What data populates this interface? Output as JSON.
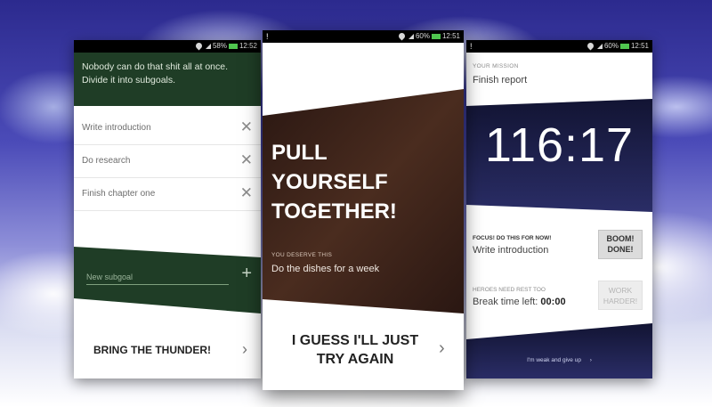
{
  "colors": {
    "forest_green": "#1f3d26",
    "brown_dark": "#3a2218",
    "navy": "#1c1e4a",
    "battery_green": "#4fc64f"
  },
  "phone1": {
    "status": {
      "battery": "58%",
      "time": "12:52"
    },
    "intro": "Nobody can do that shit all at once. Divide it into subgoals.",
    "subgoals": [
      {
        "label": "Write introduction"
      },
      {
        "label": "Do research"
      },
      {
        "label": "Finish chapter one"
      }
    ],
    "remove_glyph": "✕",
    "new_subgoal_placeholder": "New subgoal",
    "add_glyph": "+",
    "cta_label": "BRING THE THUNDER!",
    "cta_chevron": "›"
  },
  "phone2": {
    "status": {
      "alert": "!",
      "battery": "60%",
      "time": "12:51"
    },
    "headline_lines": [
      "PULL",
      "YOURSELF",
      "TOGETHER!"
    ],
    "reward_label": "YOU DESERVE THIS",
    "reward_text": "Do the dishes for a week",
    "cta_lines": [
      "I GUESS I'LL JUST",
      "TRY AGAIN"
    ],
    "cta_chevron": "›"
  },
  "phone3": {
    "status": {
      "alert": "!",
      "battery": "60%",
      "time": "12:51"
    },
    "mission_label": "YOUR MISSION",
    "mission": "Finish report",
    "timer": "116:17",
    "focus_label": "FOCUS! DO THIS FOR NOW!",
    "focus_task": "Write introduction",
    "done_button_lines": [
      "BOOM!",
      "DONE!"
    ],
    "rest_label": "HEROES NEED REST TOO",
    "break_prefix": "Break time left:",
    "break_value": "00:00",
    "work_button_lines": [
      "WORK",
      "HARDER!"
    ],
    "give_up_label": "I'm weak and give up",
    "give_up_chevron": "›"
  }
}
